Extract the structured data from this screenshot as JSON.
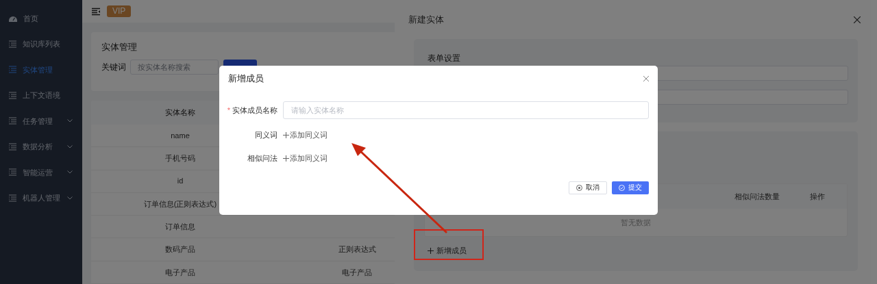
{
  "sidebar": {
    "items": [
      {
        "label": "首页",
        "selected": false,
        "expandable": false
      },
      {
        "label": "知识库列表",
        "selected": false,
        "expandable": false
      },
      {
        "label": "实体管理",
        "selected": true,
        "expandable": false
      },
      {
        "label": "上下文语境",
        "selected": false,
        "expandable": false
      },
      {
        "label": "任务管理",
        "selected": false,
        "expandable": true
      },
      {
        "label": "数据分析",
        "selected": false,
        "expandable": true
      },
      {
        "label": "智能运营",
        "selected": false,
        "expandable": true
      },
      {
        "label": "机器人管理",
        "selected": false,
        "expandable": true
      }
    ]
  },
  "header": {
    "badge": "VIP"
  },
  "search_card": {
    "title": "实体管理",
    "keyword_label": "关键词",
    "search": {
      "placeholder": "按实体名称搜索"
    }
  },
  "table": {
    "columns": [
      "实体名称"
    ],
    "rows": [
      {
        "cells": [
          "name"
        ]
      },
      {
        "cells": [
          "手机号码"
        ]
      },
      {
        "cells": [
          "id"
        ]
      },
      {
        "cells": [
          "订单信息(正则表达式)"
        ]
      },
      {
        "cells": [
          "订单信息"
        ]
      },
      {
        "cells": [
          "数码产品",
          "正则表达式"
        ]
      },
      {
        "cells": [
          "电子产品",
          "电子产品"
        ]
      }
    ]
  },
  "drawer": {
    "title": "新建实体",
    "form_card": {
      "title": "表单设置"
    },
    "members_table": {
      "columns": [
        "相似问法数量",
        "操作"
      ],
      "empty_text": "暂无数据"
    },
    "add_button": "新增成员"
  },
  "modal": {
    "title": "新增成员",
    "fields": [
      {
        "kind": "input",
        "required_mark": "*",
        "label": "实体成员名称",
        "placeholder": "请输入实体名称"
      },
      {
        "kind": "link",
        "label": "同义词",
        "link": "添加同义词"
      },
      {
        "kind": "link",
        "label": "相似问法",
        "link": "添加同义词"
      }
    ],
    "buttons": [
      {
        "kind": "secondary",
        "label": "取消"
      },
      {
        "kind": "primary",
        "label": "提交"
      }
    ]
  }
}
